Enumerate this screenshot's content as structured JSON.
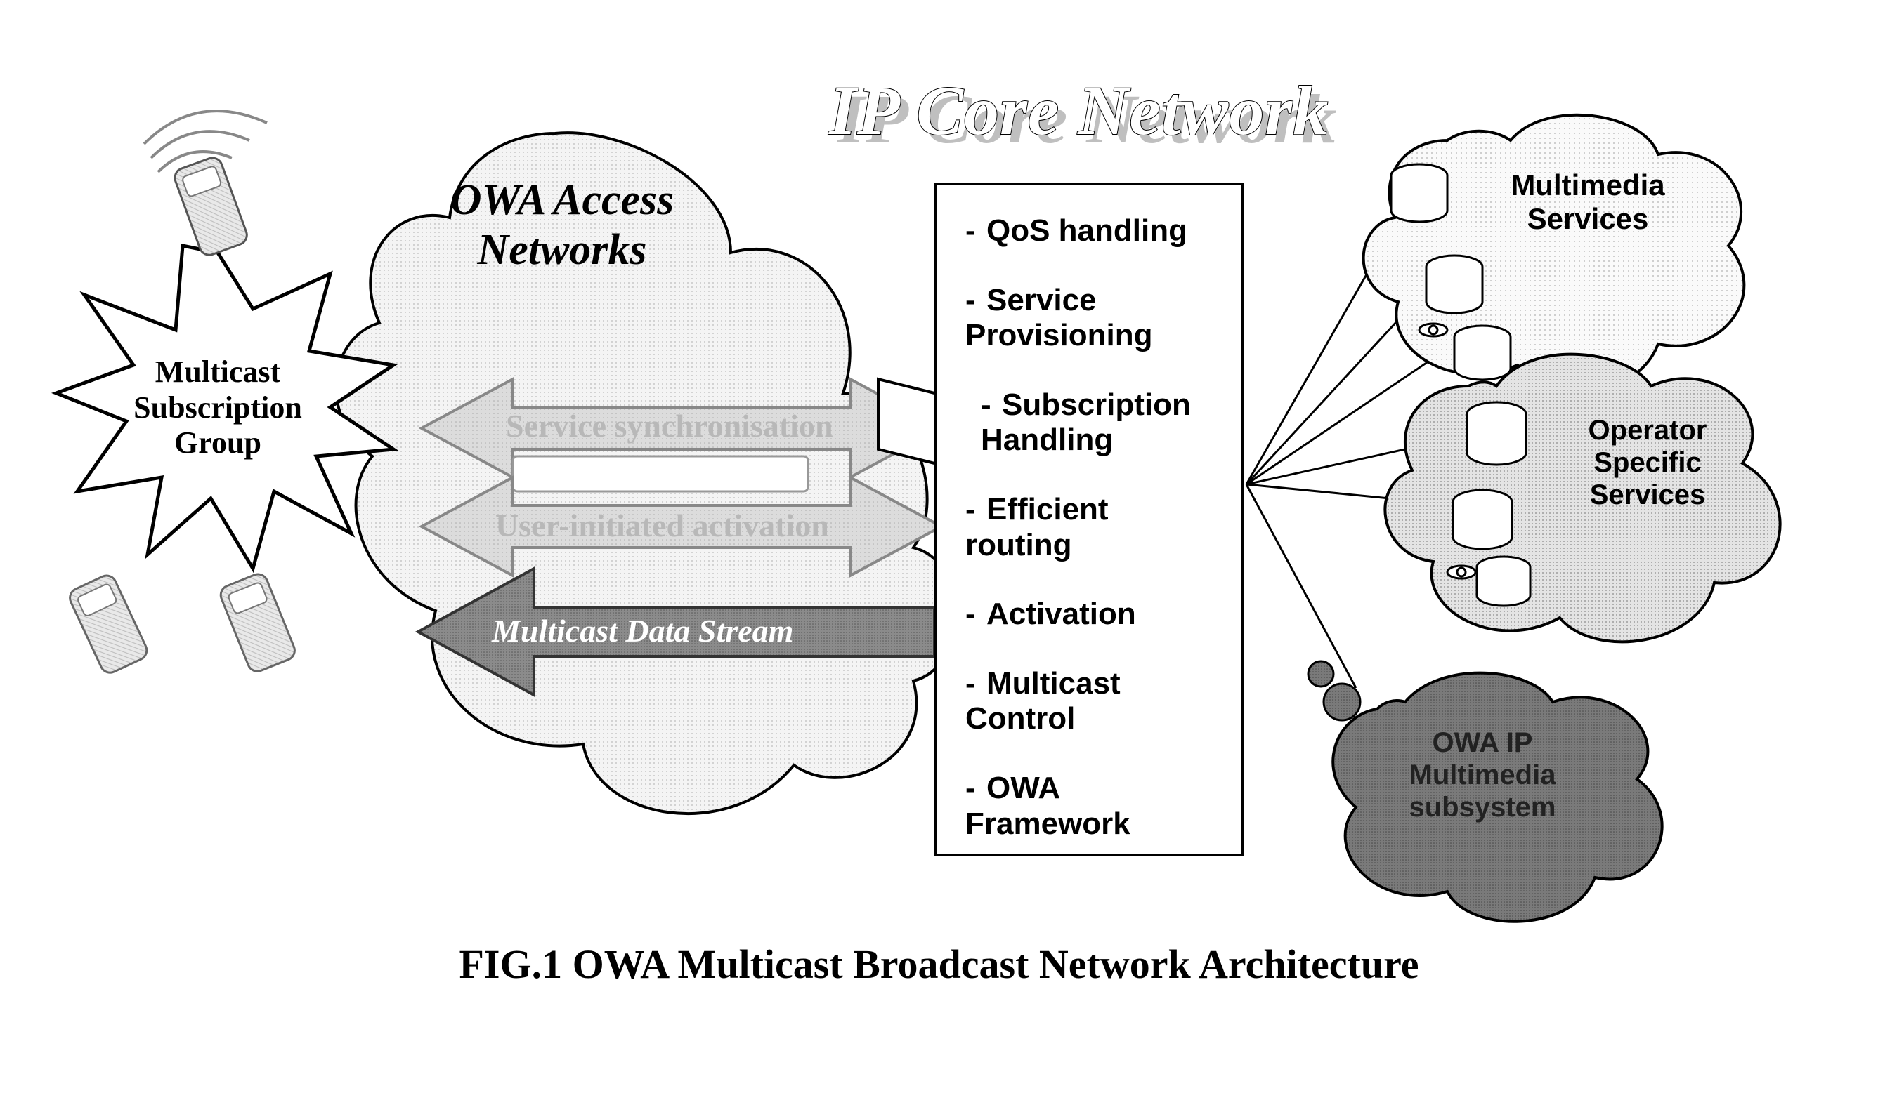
{
  "title": "IP Core Network",
  "caption": "FIG.1 OWA Multicast Broadcast Network Architecture",
  "left_group": {
    "label": "Multicast Subscription Group"
  },
  "access_network": {
    "label": "OWA Access Networks"
  },
  "arrows": {
    "sync": "Service synchronisation",
    "activation": "User-initiated activation",
    "multicast": "Multicast Data Stream"
  },
  "core_box": {
    "items": [
      "QoS handling",
      "Service Provisioning",
      "Subscription Handling",
      "Efficient routing",
      "Activation",
      "Multicast Control",
      "OWA Framework"
    ]
  },
  "right_clouds": {
    "multimedia": "Multimedia Services",
    "operator": "Operator Specific Services",
    "ims": "OWA IP Multimedia subsystem"
  }
}
